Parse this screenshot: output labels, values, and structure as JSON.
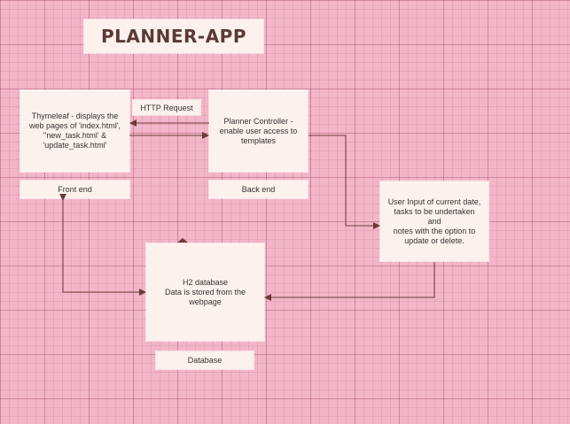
{
  "title": "PLANNER-APP",
  "nodes": {
    "front": "Thymeleaf - displays the\nweb pages of 'index.html',\n''new_task.html' &\n'update_task.html'",
    "back": "Planner Controller -\nenable user access to\ntemplates",
    "user": "User Input of current date,\ntasks to be undertaken and\nnotes with the option to\nupdate or delete.",
    "database": "H2 database\nData is stored from the\nwebpage"
  },
  "labels": {
    "front": "Front end",
    "back": "Back end",
    "database": "Database",
    "http": "HTTP Request"
  },
  "colors": {
    "background": "#f2b6c8",
    "box_fill": "#fdf1ed",
    "connector": "#6b3a3a",
    "title_text": "#5a3a35"
  }
}
